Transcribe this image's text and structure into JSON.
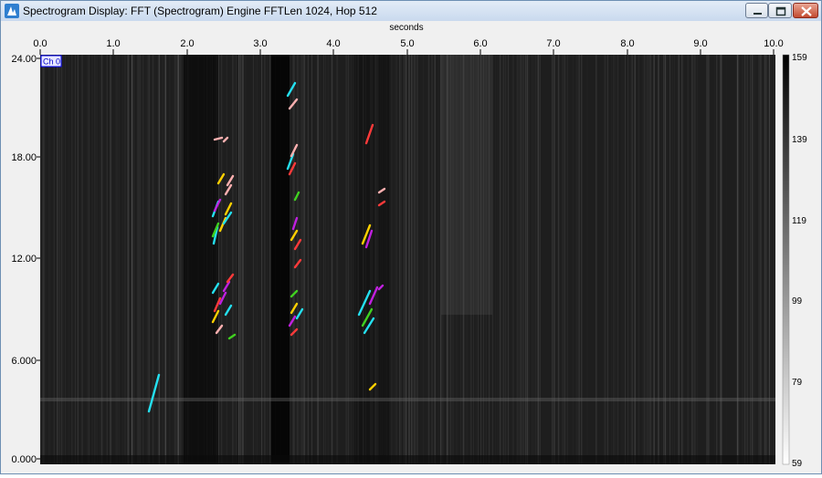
{
  "window": {
    "title": "Spectrogram Display: FFT (Spectrogram) Engine FFTLen 1024, Hop 512",
    "buttons": {
      "minimize": "minimize",
      "maximize": "maximize",
      "close": "close"
    },
    "icons": {
      "app": "app-icon",
      "minimize": "minimize-icon",
      "maximize": "maximize-icon",
      "close": "close-icon"
    }
  },
  "spectrogram": {
    "channel_label": "Ch 0",
    "x_axis": {
      "label": "seconds",
      "ticks": [
        "0.0",
        "1.0",
        "2.0",
        "3.0",
        "4.0",
        "5.0",
        "6.0",
        "7.0",
        "8.0",
        "9.0",
        "10.0"
      ]
    },
    "y_axis": {
      "ticks": [
        "0.000",
        "6.000",
        "12.00",
        "18.00",
        "24.00"
      ]
    },
    "colorbar": {
      "ticks": [
        "159",
        "139",
        "119",
        "99",
        "79",
        "59"
      ]
    },
    "call_colors": [
      "#24e0f0",
      "#ff3a3a",
      "#ffb0b0",
      "#c020e0",
      "#40d020",
      "#ffd000"
    ]
  }
}
